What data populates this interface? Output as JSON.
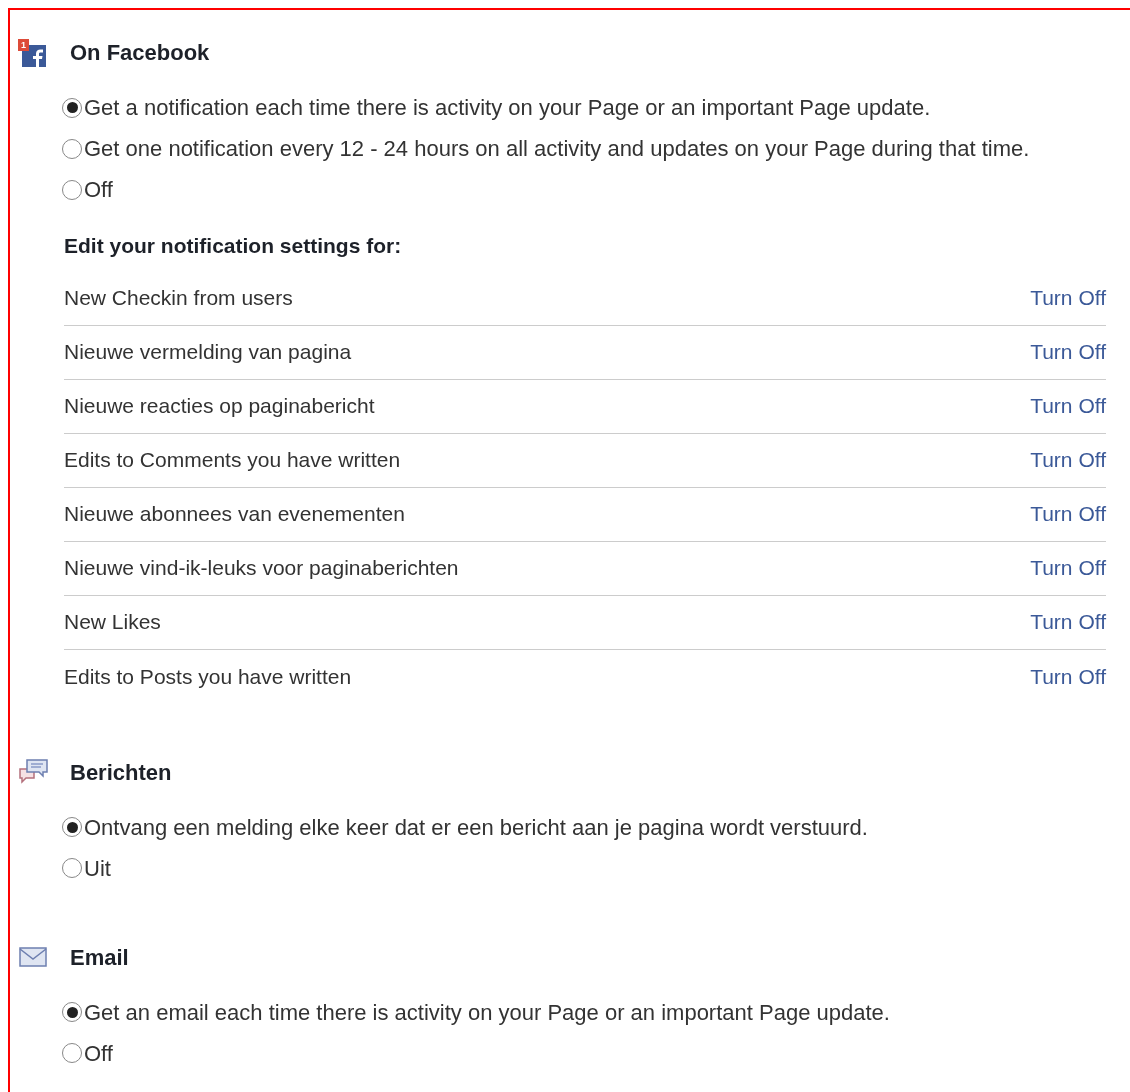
{
  "sections": [
    {
      "kind": "facebook",
      "badge": "1",
      "title": "On Facebook",
      "options": [
        {
          "label": "Get a notification each time there is activity on your Page or an important Page update.",
          "selected": true
        },
        {
          "label": "Get one notification every 12 - 24 hours on all activity and updates on your Page during that time.",
          "selected": false
        },
        {
          "label": "Off",
          "selected": false
        }
      ],
      "settings": {
        "heading": "Edit your notification settings for:",
        "items": [
          {
            "label": "New Checkin from users",
            "action": "Turn Off"
          },
          {
            "label": "Nieuwe vermelding van pagina",
            "action": "Turn Off"
          },
          {
            "label": "Nieuwe reacties op paginabericht",
            "action": "Turn Off"
          },
          {
            "label": "Edits to Comments you have written",
            "action": "Turn Off"
          },
          {
            "label": "Nieuwe abonnees van evenementen",
            "action": "Turn Off"
          },
          {
            "label": "Nieuwe vind-ik-leuks voor paginaberichten",
            "action": "Turn Off"
          },
          {
            "label": "New Likes",
            "action": "Turn Off"
          },
          {
            "label": "Edits to Posts you have written",
            "action": "Turn Off"
          }
        ]
      }
    },
    {
      "kind": "messages",
      "title": "Berichten",
      "options": [
        {
          "label": "Ontvang een melding elke keer dat er een bericht aan je pagina wordt verstuurd.",
          "selected": true
        },
        {
          "label": "Uit",
          "selected": false
        }
      ]
    },
    {
      "kind": "email",
      "title": "Email",
      "options": [
        {
          "label": "Get an email each time there is activity on your Page or an important Page update.",
          "selected": true
        },
        {
          "label": "Off",
          "selected": false
        }
      ]
    }
  ]
}
